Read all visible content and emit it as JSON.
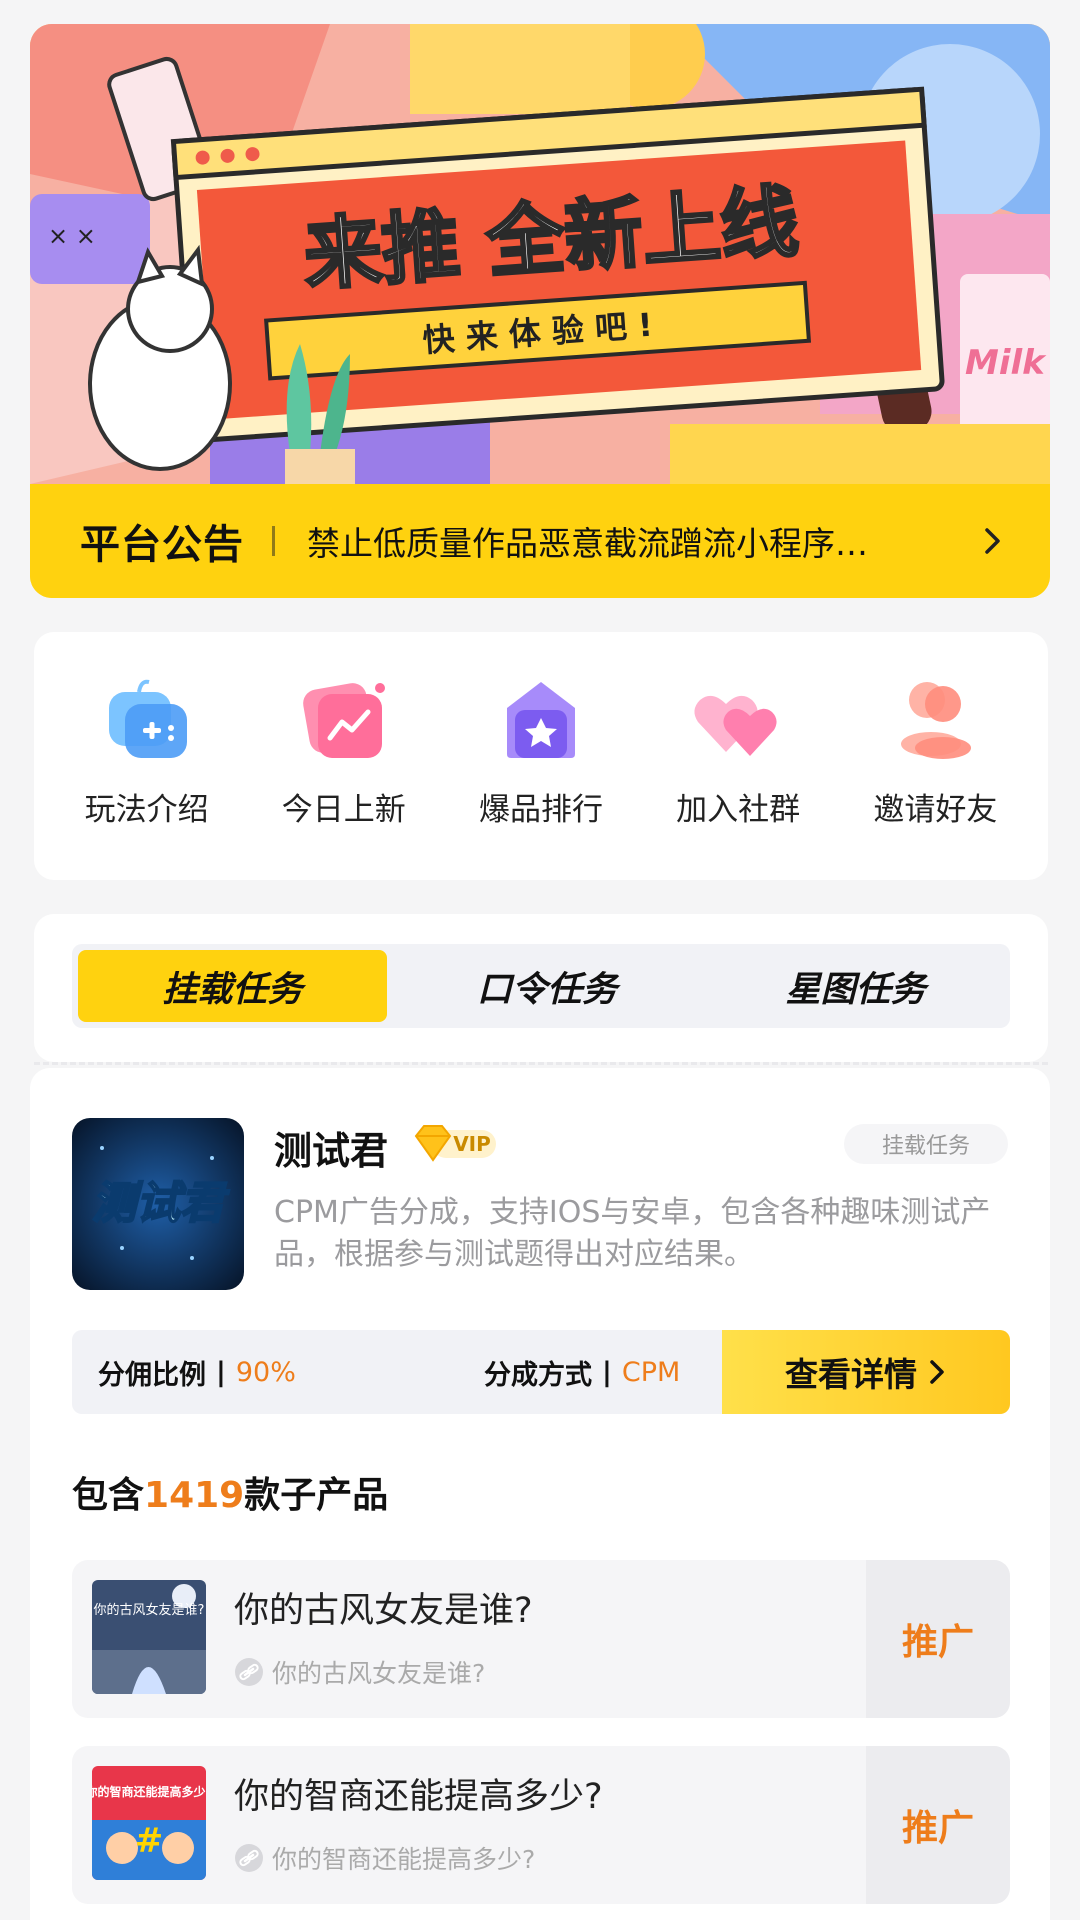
{
  "banner": {
    "headline": "来推 全新上线",
    "subline": "快 来 体 验 吧 !",
    "milk_text": "Milk",
    "notice_tag": "平台公告",
    "notice_text": "禁止低质量作品恶意截流蹭流小程序…"
  },
  "menu": [
    {
      "label": "玩法介绍",
      "icon": "gamepad-icon"
    },
    {
      "label": "今日上新",
      "icon": "trend-chart-icon"
    },
    {
      "label": "爆品排行",
      "icon": "star-rank-icon"
    },
    {
      "label": "加入社群",
      "icon": "hearts-icon"
    },
    {
      "label": "邀请好友",
      "icon": "users-icon"
    }
  ],
  "tabs": [
    {
      "label": "挂载任务",
      "active": true
    },
    {
      "label": "口令任务",
      "active": false
    },
    {
      "label": "星图任务",
      "active": false
    }
  ],
  "product": {
    "thumb_text": "测试君",
    "name": "测试君",
    "vip": "VIP",
    "type": "挂载任务",
    "desc": "CPM广告分成，支持IOS与安卓，包含各种趣味测试产品，根据参与测试题得出对应结果。",
    "commission_label": "分佣比例",
    "commission_value": "90%",
    "mode_label": "分成方式",
    "mode_value": "CPM",
    "separator": "|",
    "detail_button": "查看详情",
    "sub_prefix": "包含",
    "sub_count": "1419",
    "sub_suffix": "款子产品"
  },
  "sub_products": [
    {
      "name": "你的古风女友是谁?",
      "link": "你的古风女友是谁?",
      "thumb_text": "你的古风女友是谁?",
      "button": "推广"
    },
    {
      "name": "你的智商还能提高多少?",
      "link": "你的智商还能提高多少?",
      "thumb_text": "你的智商还能提高多少?",
      "button": "推广"
    }
  ],
  "colors": {
    "accent": "#ffd20f",
    "orange": "#ee7d1b"
  }
}
